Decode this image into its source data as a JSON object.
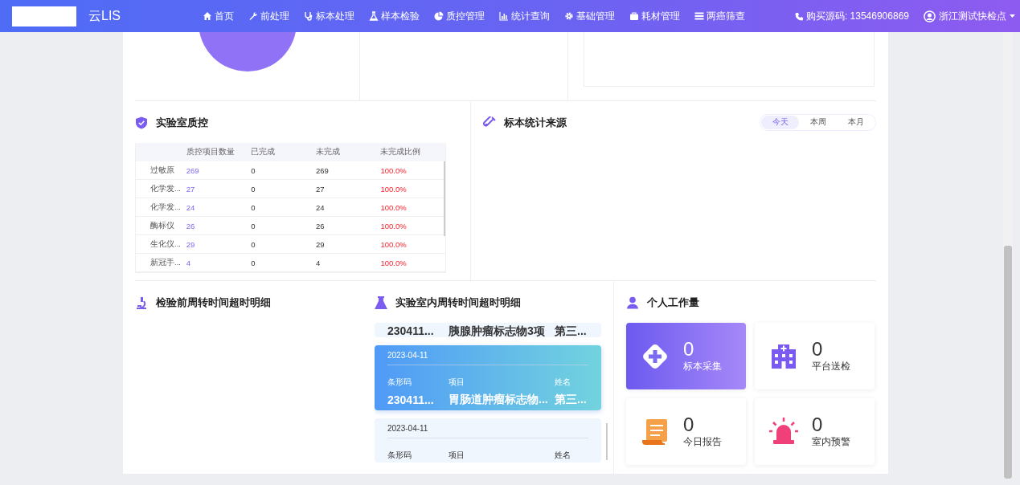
{
  "app": {
    "title": "云LIS"
  },
  "nav": [
    {
      "label": "首页"
    },
    {
      "label": "前处理"
    },
    {
      "label": "标本处理"
    },
    {
      "label": "样本检验"
    },
    {
      "label": "质控管理"
    },
    {
      "label": "统计查询"
    },
    {
      "label": "基础管理"
    },
    {
      "label": "耗材管理"
    },
    {
      "label": "两癌筛查"
    }
  ],
  "purchase": {
    "label": "购买源码: 13546906869"
  },
  "user": {
    "name": "浙江测试快检点"
  },
  "quality": {
    "title": "实验室质控",
    "columns": [
      "质控项目数量",
      "已完成",
      "未完成",
      "未完成比例"
    ],
    "rows": [
      {
        "name": "过敏原",
        "count": "269",
        "done": "0",
        "undone": "269",
        "ratio": "100.0%"
      },
      {
        "name": "化学发...",
        "count": "27",
        "done": "0",
        "undone": "27",
        "ratio": "100.0%"
      },
      {
        "name": "化学发...",
        "count": "24",
        "done": "0",
        "undone": "24",
        "ratio": "100.0%"
      },
      {
        "name": "酶标仪",
        "count": "26",
        "done": "0",
        "undone": "26",
        "ratio": "100.0%"
      },
      {
        "name": "生化仪...",
        "count": "29",
        "done": "0",
        "undone": "29",
        "ratio": "100.0%"
      },
      {
        "name": "新冠手...",
        "count": "4",
        "done": "0",
        "undone": "4",
        "ratio": "100.0%"
      }
    ]
  },
  "source": {
    "title": "标本统计来源",
    "ranges": [
      {
        "label": "今天",
        "selected": true
      },
      {
        "label": "本周",
        "selected": false
      },
      {
        "label": "本月",
        "selected": false
      }
    ]
  },
  "pre_timeout": {
    "title": "检验前周转时间超时明细"
  },
  "lab_timeout": {
    "title": "实验室内周转时间超时明细",
    "cards": [
      {
        "selected": false,
        "values": [
          "230411...",
          "胰腺肿瘤标志物3项",
          "第三..."
        ]
      },
      {
        "selected": true,
        "date": "2023-04-11",
        "labels": [
          "条形码",
          "项目",
          "姓名"
        ],
        "values": [
          "230411...",
          "胃肠道肿瘤标志物...",
          "第三..."
        ]
      },
      {
        "selected": false,
        "date": "2023-04-11",
        "labels": [
          "条形码",
          "项目",
          "姓名"
        ]
      }
    ]
  },
  "workload": {
    "title": "个人工作量",
    "tiles": [
      {
        "value": "0",
        "label": "标本采集",
        "selected": true
      },
      {
        "value": "0",
        "label": "平台送检",
        "selected": false
      },
      {
        "value": "0",
        "label": "今日报告",
        "selected": false
      },
      {
        "value": "0",
        "label": "室内预警",
        "selected": false
      }
    ]
  }
}
